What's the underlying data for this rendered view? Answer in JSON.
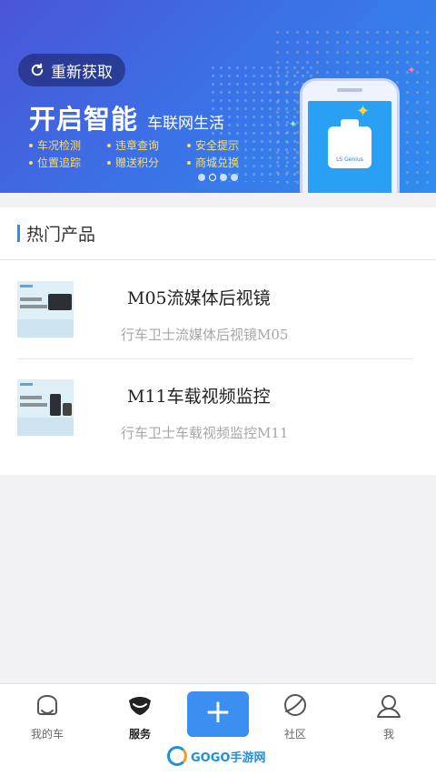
{
  "banner": {
    "refresh_label": "重新获取",
    "headline": "开启智能",
    "subline": "车联网生活",
    "features": [
      "车况检测",
      "违章查询",
      "安全提示",
      "位置追踪",
      "赠送积分",
      "商城兑换"
    ],
    "device_label": "LS Genius",
    "slide_count": 4,
    "active_slide": 2
  },
  "hot_products": {
    "section_title": "热门产品",
    "items": [
      {
        "title": "M05流媒体后视镜",
        "subtitle": "行车卫士流媒体后视镜M05"
      },
      {
        "title": "M11车载视频监控",
        "subtitle": "行车卫士车载视频监控M11"
      }
    ]
  },
  "tabbar": {
    "tabs": [
      {
        "label": "我的车",
        "icon": "car-icon"
      },
      {
        "label": "服务",
        "icon": "service-icon",
        "active": true
      },
      {
        "label": "+",
        "icon": "add-icon"
      },
      {
        "label": "社区",
        "icon": "community-icon"
      },
      {
        "label": "我",
        "icon": "profile-icon"
      }
    ]
  },
  "watermark": {
    "text": "GOGO手游网"
  },
  "colors": {
    "accent": "#3b8ff0",
    "banner_start": "#4a55d8",
    "banner_end": "#2f8df0",
    "feature_text": "#ffdf5e"
  }
}
